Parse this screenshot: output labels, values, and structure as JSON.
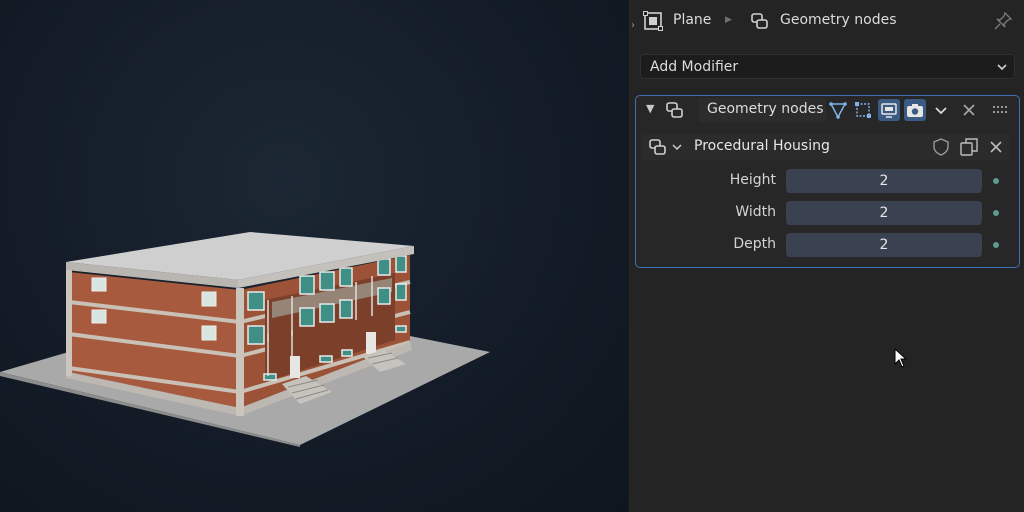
{
  "breadcrumb": {
    "object_name": "Plane",
    "modifier_name": "Geometry nodes"
  },
  "add_modifier": {
    "label": "Add Modifier"
  },
  "modifier": {
    "name": "Geometry nodes",
    "node_group": "Procedural Housing",
    "inputs": [
      {
        "label": "Height",
        "value": "2"
      },
      {
        "label": "Width",
        "value": "2"
      },
      {
        "label": "Depth",
        "value": "2"
      }
    ]
  },
  "colors": {
    "panel_bg": "#242424",
    "accent_border": "#3f6fb4",
    "field_bg": "#3a4150",
    "active_toggle": "#3b5b85",
    "brick": "#a85a3e"
  }
}
